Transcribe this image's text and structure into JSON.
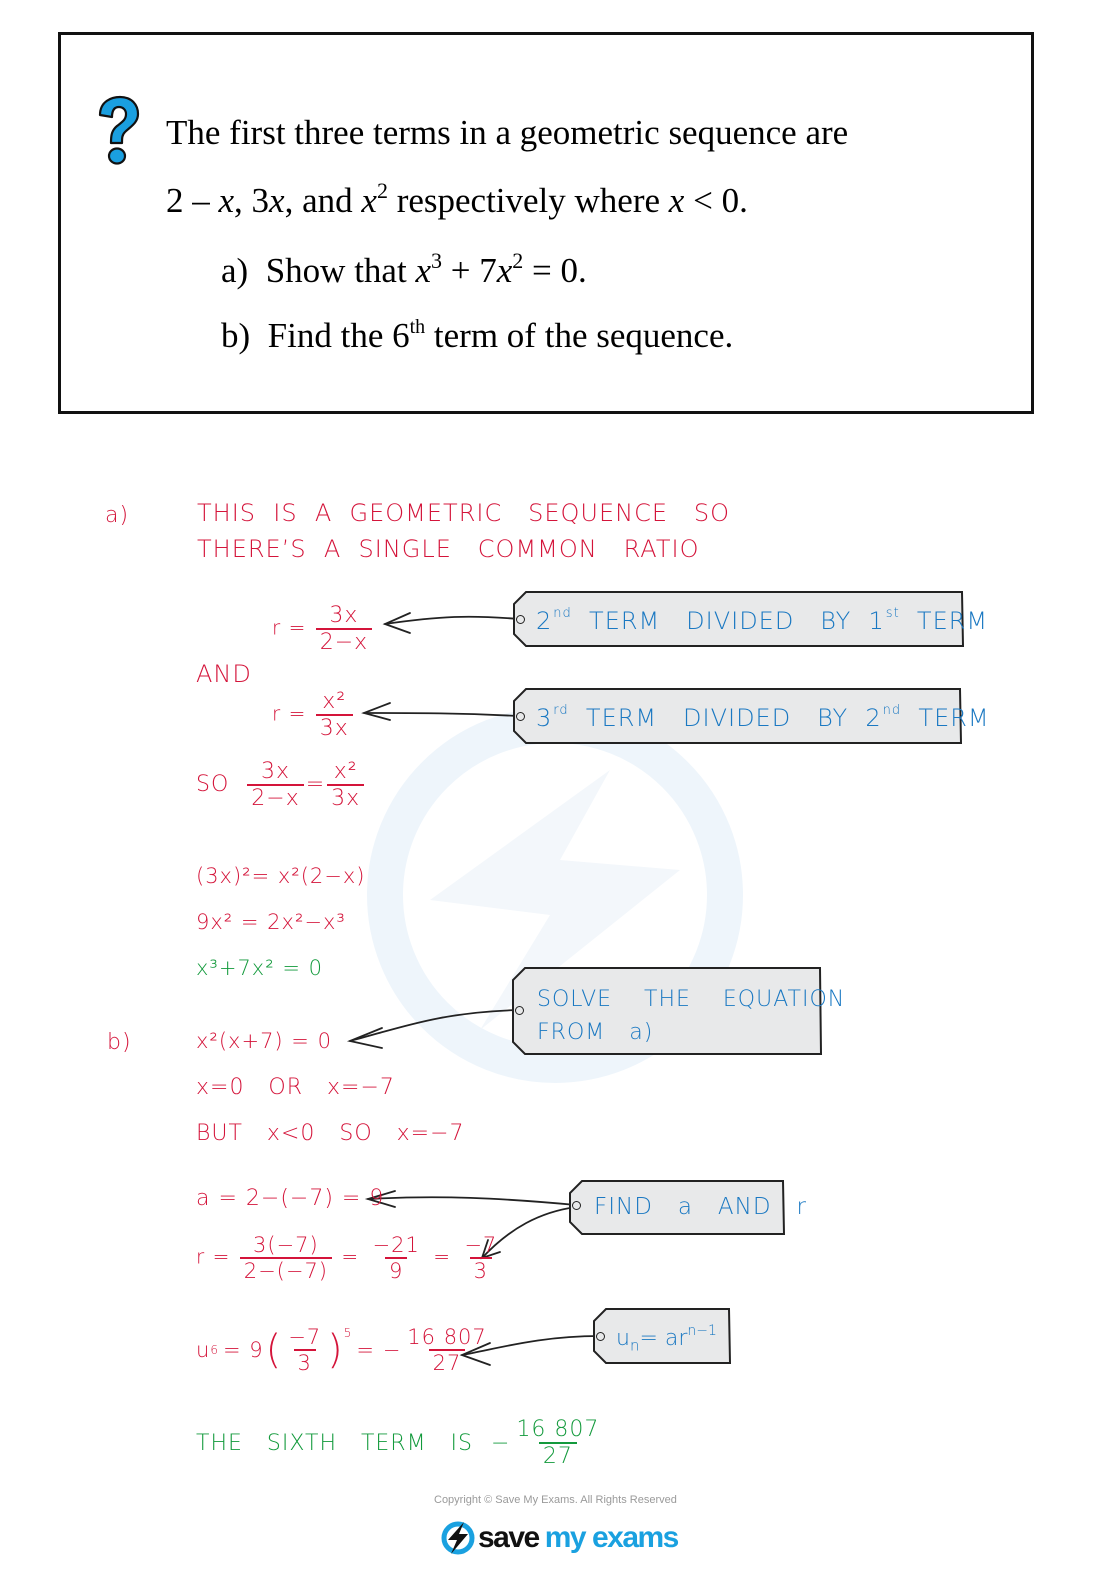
{
  "question": {
    "icon": "question-mark-icon",
    "line1": "The first three terms in a geometric sequence are",
    "line2": {
      "t1": "2 – ",
      "x1": "x",
      "t2": ", 3",
      "x2": "x",
      "t3": ", and ",
      "x3": "x",
      "sup3": "2",
      "t4": " respectively where ",
      "x4": "x",
      "t5": " < 0."
    },
    "part_a": {
      "label": "a)",
      "text": "Show that ",
      "x1": "x",
      "sup1": "3",
      "mid": " + 7",
      "x2": "x",
      "sup2": "2",
      "end": " = 0."
    },
    "part_b": {
      "label": "b)",
      "text1": "Find the 6",
      "sup": "th",
      "text2": " term of the sequence."
    }
  },
  "solution": {
    "part_a_label": "a)",
    "part_b_label": "b)",
    "intro_line1": "THIS  IS  A  GEOMETRIC   SEQUENCE   SO",
    "intro_line2": "THERE’S  A  SINGLE   COMMON   RATIO",
    "r1": {
      "lhs": "r =",
      "num": "3x",
      "den": "2−x"
    },
    "and_label": "AND",
    "r2": {
      "lhs": "r =",
      "num": "x²",
      "den": "3x"
    },
    "so_eq": {
      "so": "SO",
      "num1": "3x",
      "den1": "2−x",
      "eq": "=",
      "num2": "x²",
      "den2": "3x"
    },
    "step1": "(3x)²= x²(2−x)",
    "step2": "9x² = 2x²−x³",
    "result_a": "x³+7x² = 0",
    "b_step1": "x²(x+7) = 0",
    "b_step2": "x=0   OR   x=−7",
    "b_step3": "BUT   x<0   SO   x=−7",
    "a_value": "a = 2−(−7) = 9",
    "r_value": {
      "lhs": "r =",
      "num1": "3(−7)",
      "den1": "2−(−7)",
      "num2": "−21",
      "den2": "9",
      "num3": "−7",
      "den3": "3",
      "eq": "="
    },
    "u6": {
      "lhs": "u",
      "sub": "6",
      "eq1": "= 9",
      "num": "−7",
      "den": "3",
      "power": "5",
      "eq2": "= −",
      "rnum": "16 807",
      "rden": "27"
    },
    "final": {
      "text": "THE   SIXTH   TERM   IS",
      "sign": "−",
      "num": "16 807",
      "den": "27"
    }
  },
  "callouts": [
    {
      "id": "tag-2nd-over-1st",
      "pre": "2",
      "sup1": "nd",
      "mid": "  TERM   DIVIDED   BY  1",
      "sup2": "st",
      "post": "  TERM"
    },
    {
      "id": "tag-3rd-over-2nd",
      "pre": "3",
      "sup1": "rd",
      "mid": "  TERM   DIVIDED   BY  2",
      "sup2": "nd",
      "post": "  TERM"
    },
    {
      "id": "tag-solve",
      "line1": "SOLVE    THE    EQUATION",
      "line2": "FROM   a)"
    },
    {
      "id": "tag-find",
      "text": "FIND   a   AND   r"
    },
    {
      "id": "tag-formula",
      "pre": "u",
      "sub": "n",
      "mid": "= ar",
      "sup": "n−1"
    }
  ],
  "colors": {
    "working": "#d4143a",
    "answer": "#139a3c",
    "callout_text": "#1a78c2",
    "callout_fill": "#e8e9ea",
    "question_icon": "#1a9fe0",
    "logo_accent": "#1aa1e0"
  },
  "footer": {
    "copyright": "Copyright © Save My Exams. All Rights Reserved",
    "logo_word1": "save",
    "logo_word2": "my exams",
    "logo_icon": "lightning-bolt-icon"
  }
}
